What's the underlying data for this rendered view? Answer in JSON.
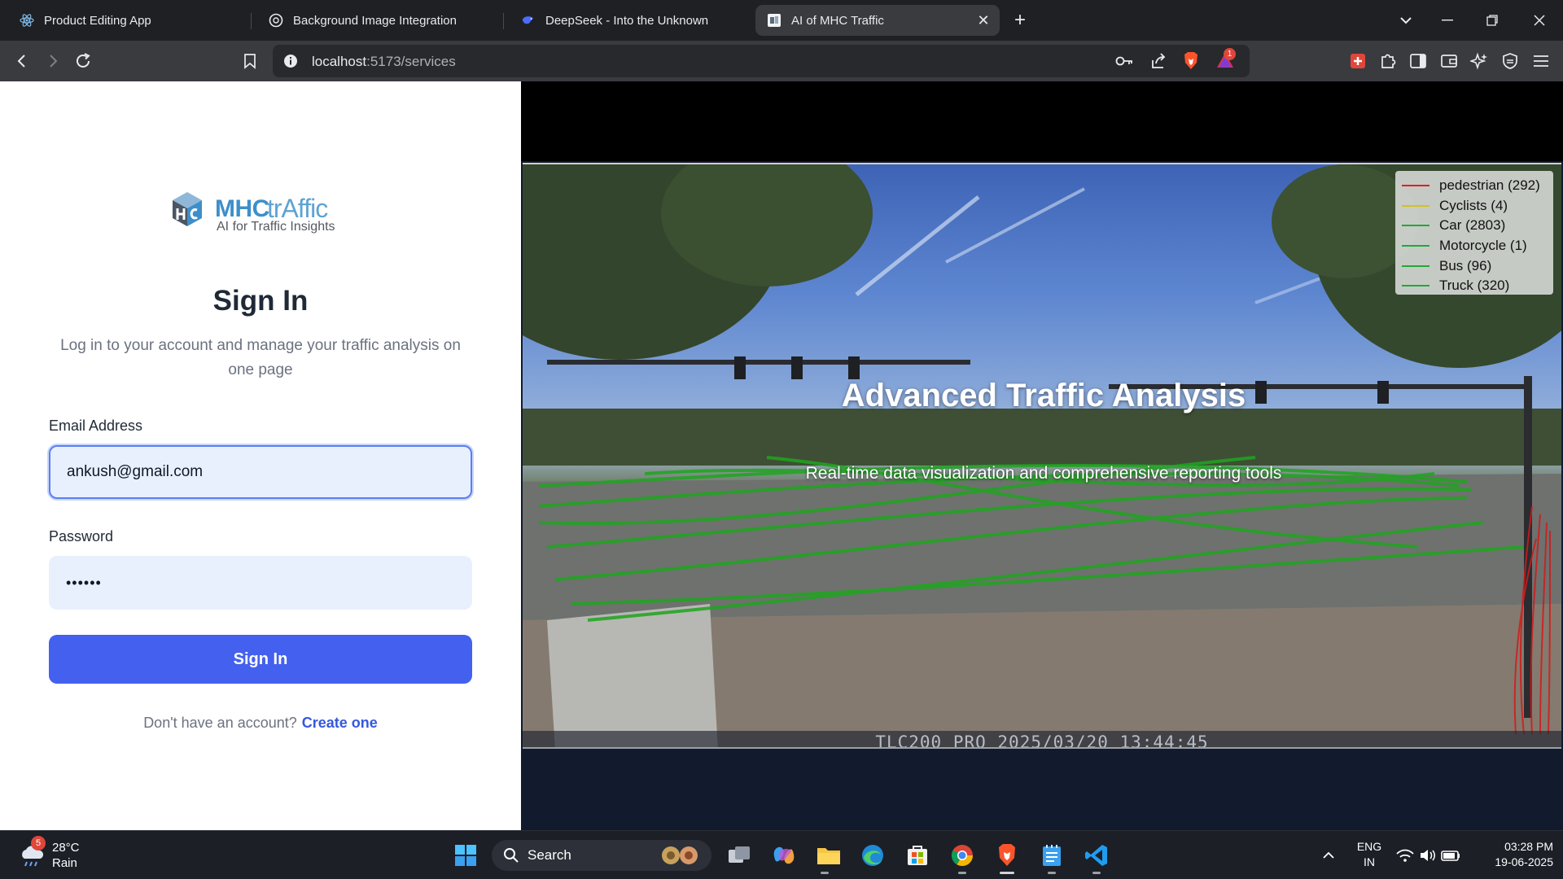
{
  "browser": {
    "tabs": [
      {
        "title": "Product Editing App",
        "icon": "react-icon"
      },
      {
        "title": "Background Image Integration",
        "icon": "openai-icon"
      },
      {
        "title": "DeepSeek - Into the Unknown",
        "icon": "deepseek-icon"
      },
      {
        "title": "AI of MHC Traffic",
        "icon": "page-icon",
        "active": true
      }
    ],
    "url_host": "localhost",
    "url_path": ":5173/services",
    "shield_badge": "1"
  },
  "login": {
    "logo_mhc": "MHC",
    "logo_traffic": "trAffic",
    "logo_tagline": "AI for Traffic Insights",
    "title": "Sign In",
    "subtitle": "Log in to your account and manage your traffic analysis on one page",
    "email_label": "Email Address",
    "email_value": "ankush@gmail.com",
    "password_label": "Password",
    "password_value": "••••••",
    "submit_label": "Sign In",
    "signup_prompt": "Don't have an account?",
    "signup_link": "Create one"
  },
  "hero": {
    "title": "Advanced Traffic Analysis",
    "subtitle": "Real-time data visualization and comprehensive reporting tools",
    "camera_stamp": "TLC200 PRO 2025/03/20 13:44:45",
    "legend": [
      {
        "label": "pedestrian (292)",
        "color": "#e02020"
      },
      {
        "label": "Cyclists (4)",
        "color": "#d4c21a"
      },
      {
        "label": "Car (2803)",
        "color": "#22a83a"
      },
      {
        "label": "Motorcycle (1)",
        "color": "#22a83a"
      },
      {
        "label": "Bus (96)",
        "color": "#22a83a"
      },
      {
        "label": "Truck (320)",
        "color": "#22a83a"
      }
    ]
  },
  "taskbar": {
    "weather_temp": "28°C",
    "weather_cond": "Rain",
    "weather_badge": "5",
    "search_label": "Search",
    "lang_line1": "ENG",
    "lang_line2": "IN",
    "time": "03:28 PM",
    "date": "19-06-2025"
  }
}
